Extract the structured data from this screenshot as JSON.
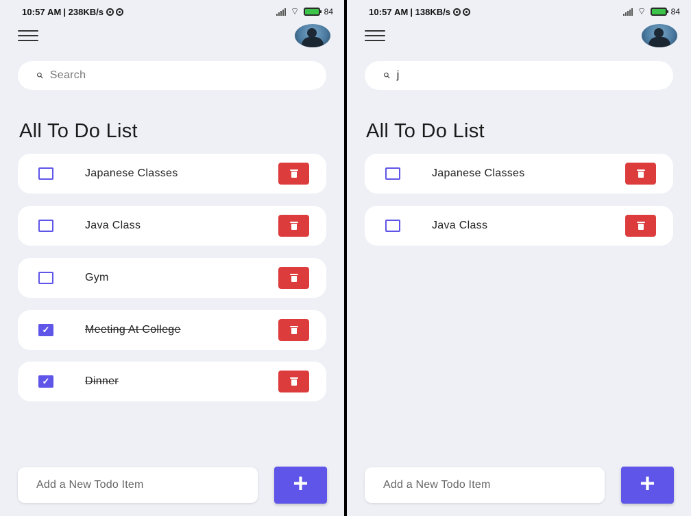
{
  "screens": [
    {
      "status": {
        "time": "10:57 AM",
        "speed": "| 238KB/s",
        "battery": "84"
      },
      "search": {
        "icon": "search-icon",
        "text": "Search",
        "is_placeholder": true
      },
      "title": "All To Do List",
      "todos": [
        {
          "text": "Japanese Classes",
          "done": false
        },
        {
          "text": "Java Class",
          "done": false
        },
        {
          "text": "Gym",
          "done": false
        },
        {
          "text": "Meeting At College",
          "done": true
        },
        {
          "text": "Dinner",
          "done": true
        }
      ],
      "add": {
        "placeholder": "Add a New Todo Item",
        "button_label": "+"
      }
    },
    {
      "status": {
        "time": "10:57 AM",
        "speed": "| 138KB/s",
        "battery": "84"
      },
      "search": {
        "icon": "search-icon",
        "text": "j",
        "is_placeholder": false
      },
      "title": "All To Do List",
      "todos": [
        {
          "text": "Japanese Classes",
          "done": false
        },
        {
          "text": "Java Class",
          "done": false
        }
      ],
      "add": {
        "placeholder": "Add a New Todo Item",
        "button_label": "+"
      }
    }
  ],
  "colors": {
    "accent": "#5f55e8",
    "delete": "#dc3c3c",
    "background": "#eef0f5",
    "card": "#ffffff"
  },
  "icons": {
    "menu": "hamburger-menu-icon",
    "delete": "trash-icon",
    "check": "checkmark-icon",
    "add": "plus-icon",
    "profile": "avatar"
  }
}
